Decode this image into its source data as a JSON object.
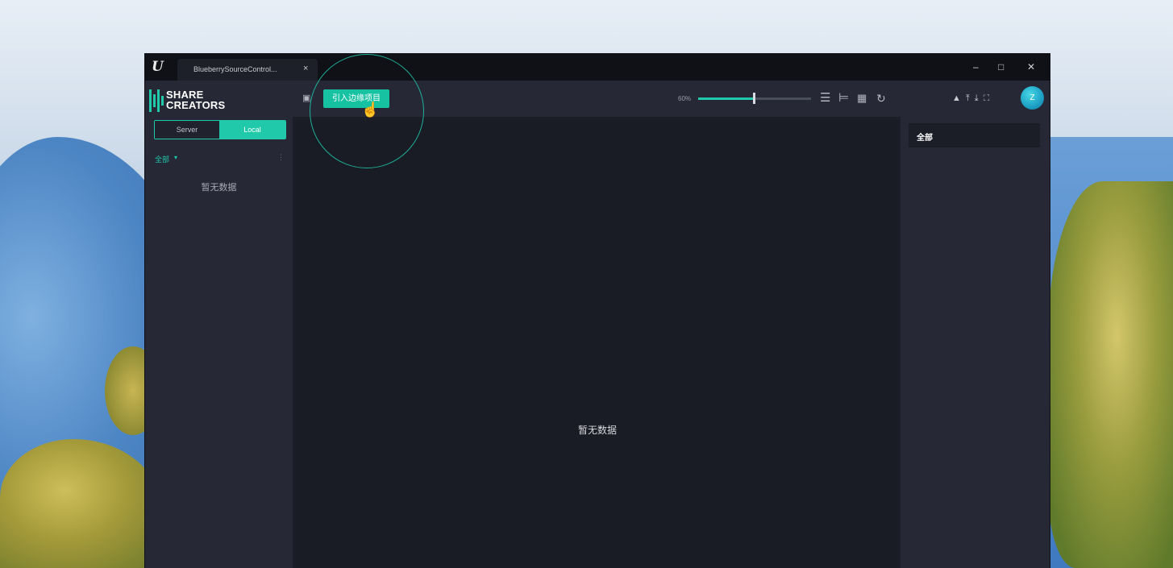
{
  "window": {
    "tab_title": "BlueberrySourceControl...",
    "tab_close": "×",
    "controls": {
      "minimize": "–",
      "maximize": "□",
      "close": "✕"
    }
  },
  "brand": {
    "line1": "SHARE",
    "line2": "CREATORS"
  },
  "sidebar": {
    "toggle": {
      "server": "Server",
      "local": "Local",
      "selected": "Local"
    },
    "filter_label": "全部",
    "filter_caret": "▾",
    "more": "⋮",
    "empty_text": "暂无数据"
  },
  "toolbar": {
    "import_button": "引入边缘项目",
    "zoom_label": "60%",
    "zoom_fraction": 0.5,
    "view_icons": [
      "list-view-icon",
      "tree-view-icon",
      "grid-view-icon",
      "refresh-icon"
    ]
  },
  "main": {
    "empty_text": "暂无数据"
  },
  "right_panel": {
    "action_icons": [
      "bell-icon",
      "upload-icon",
      "download-icon",
      "fullscreen-icon"
    ],
    "avatar_text": "Z",
    "list": [
      {
        "label": "全部"
      }
    ]
  },
  "colors": {
    "accent": "#1fc9a9",
    "titlebar": "#101116",
    "panel": "#262836",
    "content": "#1b1d27"
  }
}
